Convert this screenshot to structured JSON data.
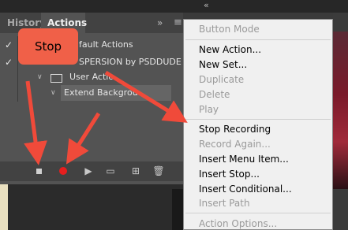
{
  "top_strip": {
    "chevrons": "«"
  },
  "tabs": [
    {
      "label": "History",
      "active": false
    },
    {
      "label": "Actions",
      "active": true
    }
  ],
  "panel_header": {
    "expand_glyph": "»",
    "menu_glyph": "≡"
  },
  "actions_list": [
    {
      "label": "Default Actions",
      "visible_label": "fault Actions",
      "checked": true
    },
    {
      "label": "DISPERSION by PSDDUDE",
      "visible_label": "SPERSION by PSDDUDE",
      "checked": true
    },
    {
      "label": "User Actions",
      "visible_label": "User Actio"
    },
    {
      "label": "Extend Background",
      "visible_label": "Extend Backgrou",
      "selected": true
    }
  ],
  "bottom_toolbar": [
    {
      "name": "stop",
      "icon": "stop-icon"
    },
    {
      "name": "record",
      "icon": "record-icon",
      "color": "#e61e1e"
    },
    {
      "name": "play",
      "icon": "play-icon"
    },
    {
      "name": "new-set",
      "icon": "folder-icon"
    },
    {
      "name": "new-action",
      "icon": "new-item-icon"
    },
    {
      "name": "delete",
      "icon": "trash-icon"
    }
  ],
  "callout": {
    "label": "Stop",
    "color": "#f06048"
  },
  "context_menu": {
    "items": [
      {
        "label": "Button Mode",
        "enabled": false
      },
      {
        "label": "New Action...",
        "enabled": true
      },
      {
        "label": "New Set...",
        "enabled": true
      },
      {
        "label": "Duplicate",
        "enabled": false
      },
      {
        "label": "Delete",
        "enabled": false
      },
      {
        "label": "Play",
        "enabled": false
      },
      {
        "label": "Stop Recording",
        "enabled": true
      },
      {
        "label": "Record Again...",
        "enabled": false
      },
      {
        "label": "Insert Menu Item...",
        "enabled": true
      },
      {
        "label": "Insert Stop...",
        "enabled": true
      },
      {
        "label": "Insert Conditional...",
        "enabled": true
      },
      {
        "label": "Insert Path",
        "enabled": false
      },
      {
        "label": "Action Options...",
        "enabled": false
      }
    ]
  }
}
